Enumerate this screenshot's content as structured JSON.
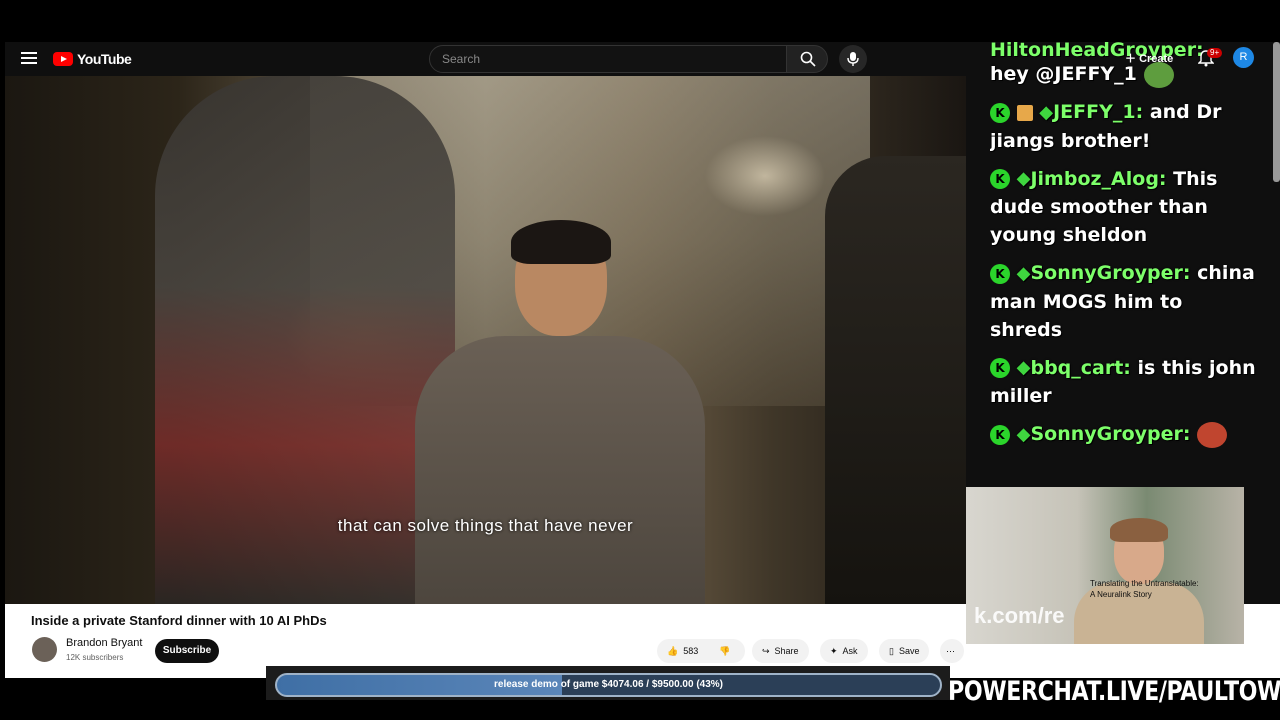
{
  "header": {
    "logo_text": "YouTube",
    "search_placeholder": "Search",
    "create_label": "Create",
    "notification_count": "9+",
    "avatar_letter": "R"
  },
  "video": {
    "subtitle": "that can solve things that have never",
    "title": "Inside a private Stanford dinner with 10 AI PhDs"
  },
  "channel": {
    "name": "Brandon Bryant",
    "subscribers": "12K subscribers",
    "subscribe_label": "Subscribe"
  },
  "actions": {
    "likes": "583",
    "share": "Share",
    "ask": "Ask",
    "save": "Save"
  },
  "chat": [
    {
      "user": "HiltonHeadGroyper:",
      "text": ""
    },
    {
      "user": "",
      "text": "hey @JEFFY_1"
    },
    {
      "user": "JEFFY_1:",
      "text": "and Dr jiangs brother!"
    },
    {
      "user": "Jimboz_Alog:",
      "text": "This dude smoother than young sheldon"
    },
    {
      "user": "SonnyGroyper:",
      "text": "china man MOGS him to shreds"
    },
    {
      "user": "bbq_cart:",
      "text": "is this john miller"
    },
    {
      "user": "SonnyGroyper:",
      "text": ""
    }
  ],
  "sidebar_preview": {
    "title_line1": "Translating the Untranslatable:",
    "title_line2": "A Neuralink Story",
    "thumb_text": "k.com/re"
  },
  "goal_bar": {
    "text": "release demo of game $4074.06 / $9500.00 (43%)",
    "progress": 0.43
  },
  "stream_url": "POWERCHAT.LIVE/PAULTOWN"
}
